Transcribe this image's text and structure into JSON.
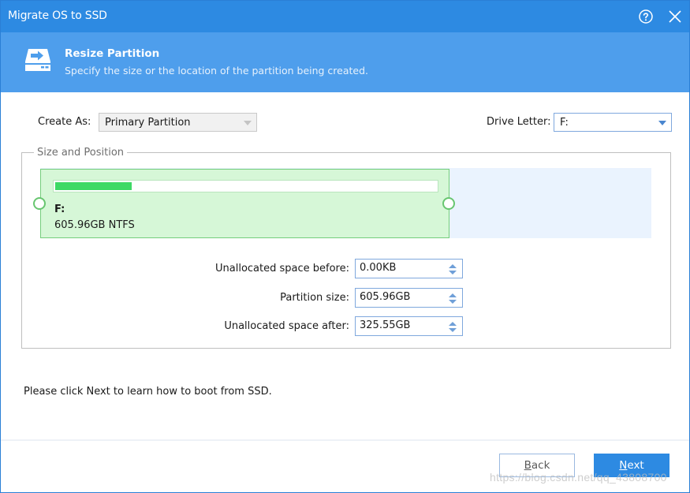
{
  "window": {
    "title": "Migrate OS to SSD",
    "help_icon": "question-circle-icon",
    "close_icon": "close-x-icon"
  },
  "header": {
    "icon": "disk-arrow-icon",
    "title": "Resize Partition",
    "subtitle": "Specify the size or the location of the partition being created."
  },
  "form": {
    "create_as_label": "Create As:",
    "create_as_value": "Primary Partition",
    "drive_letter_label": "Drive Letter:",
    "drive_letter_value": "F:"
  },
  "size_position": {
    "legend": "Size and Position",
    "partition": {
      "letter": "F:",
      "info": "605.96GB NTFS",
      "used_fraction": 0.2,
      "partition_fraction_of_disk": 0.6505
    },
    "fields": [
      {
        "label": "Unallocated space before:",
        "value": "0.00KB"
      },
      {
        "label": "Partition size:",
        "value": "605.96GB"
      },
      {
        "label": "Unallocated space after:",
        "value": "325.55GB"
      }
    ]
  },
  "note": "Please click Next to learn how to boot from SSD.",
  "buttons": {
    "back_mnemonic": "B",
    "back_rest": "ack",
    "next_mnemonic": "N",
    "next_rest": "ext"
  },
  "watermark": "https://blog.csdn.net/qq_43808700",
  "colors": {
    "titlebar": "#2d8ae2",
    "header": "#4e9eec",
    "partition_fill": "#d6f7d7",
    "usage_fill": "#3ed965",
    "unallocated": "#eaf3fe"
  }
}
